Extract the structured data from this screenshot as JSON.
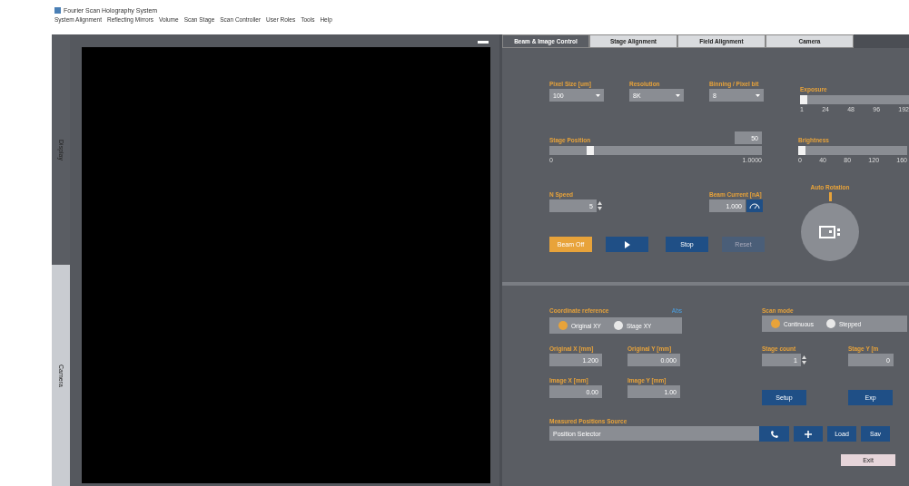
{
  "window": {
    "title": "Fourier Scan Holography System"
  },
  "menu": [
    "System Alignment",
    "Reflecting Mirrors",
    "Volume",
    "Scan Stage",
    "Scan Controller",
    "User Roles",
    "Tools",
    "Help"
  ],
  "side_tabs": [
    {
      "label": "Display",
      "selected": false
    },
    {
      "label": "Camera",
      "selected": true
    }
  ],
  "tabs": [
    {
      "label": "Beam & Image Control",
      "selected": true
    },
    {
      "label": "Stage Alignment",
      "selected": false
    },
    {
      "label": "Field Alignment",
      "selected": false
    },
    {
      "label": "Camera",
      "selected": false
    }
  ],
  "beam": {
    "dropdowns": [
      {
        "label": "Pixel Size [um]",
        "value": "100"
      },
      {
        "label": "Resolution",
        "value": "8K"
      },
      {
        "label": "Binning / Pixel bit",
        "value": "8"
      }
    ],
    "stage_position": {
      "label": "Stage Position",
      "value": "50",
      "level": 0.18,
      "min": "0",
      "max": "1.0000"
    },
    "exposure": {
      "label": "Exposure",
      "level": 0,
      "ticks": [
        "1",
        "24",
        "48",
        "96",
        "192"
      ]
    },
    "brightness": {
      "label": "Brightness",
      "level": 0,
      "ticks": [
        "0",
        "40",
        "80",
        "120",
        "160"
      ]
    },
    "speed": {
      "label": "N Speed",
      "value": "5"
    },
    "current": {
      "label": "Beam Current [nA]",
      "value": "1.000"
    },
    "rotation": {
      "label": "Auto Rotation"
    },
    "buttons": [
      {
        "kind": "warning",
        "label": "Beam Off"
      },
      {
        "kind": "play"
      },
      {
        "kind": "primary",
        "label": "Stop"
      },
      {
        "kind": "disabled",
        "label": "Reset"
      }
    ]
  },
  "coords": {
    "label": "Coordinate reference",
    "link": "Abs",
    "options": [
      {
        "label": "Original XY",
        "selected": true
      },
      {
        "label": "Stage XY",
        "selected": false
      }
    ]
  },
  "scan_mode": {
    "label": "Scan mode",
    "options": [
      {
        "label": "Continuous",
        "selected": true
      },
      {
        "label": "Stepped",
        "selected": false
      }
    ]
  },
  "fields": [
    {
      "label": "Original X [mm]",
      "value": "1.200"
    },
    {
      "label": "Original Y [mm]",
      "value": "0.000"
    },
    {
      "label": "Image X [mm]",
      "value": "0.00"
    },
    {
      "label": "Image Y [mm]",
      "value": "1.00"
    }
  ],
  "stage_count": {
    "label": "Stage count",
    "value": "1"
  },
  "stage_y": {
    "label": "Stage Y [m",
    "value": "0"
  },
  "action_buttons": [
    "Setup",
    "Exp"
  ],
  "positions": {
    "label": "Measured Positions Source",
    "value": "Position Selector",
    "buttons": [
      "Load",
      "Sav"
    ]
  },
  "exit": "Exit"
}
